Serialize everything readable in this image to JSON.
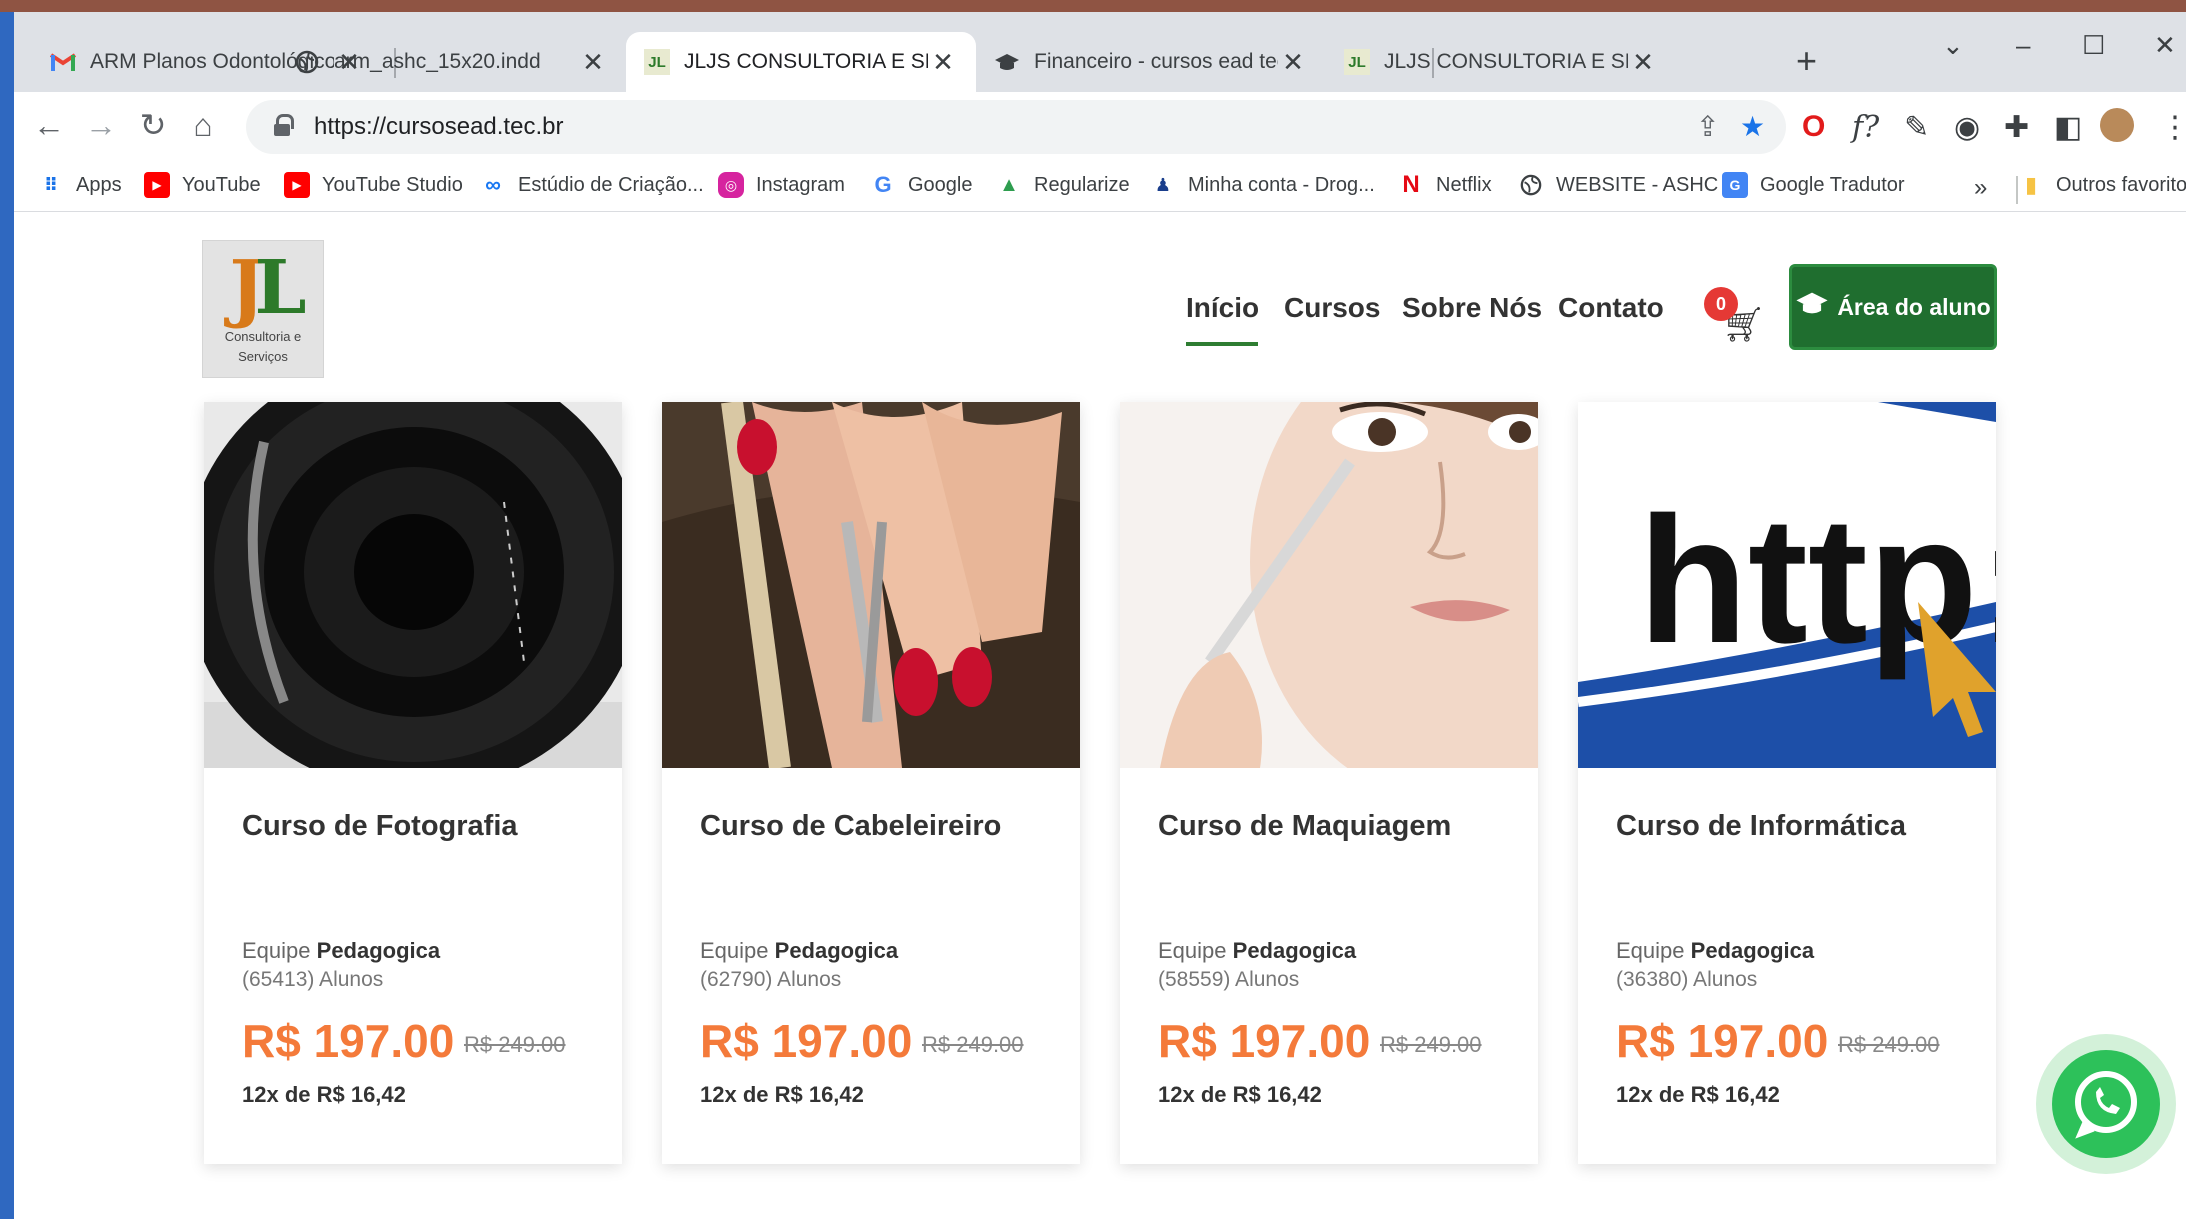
{
  "browser": {
    "tabs": [
      {
        "title": "ARM Planos Odontológico -",
        "icon": "gmail-icon"
      },
      {
        "title": "arm_ashc_15x20.indd",
        "icon": "globe-icon"
      },
      {
        "title": "JLJS CONSULTORIA E SERVIÇ",
        "icon": "jljs-icon",
        "active": true
      },
      {
        "title": "Financeiro - cursos ead tec -",
        "icon": "graduation-cap-icon"
      },
      {
        "title": "JLJS CONSULTORIA E SERVIÇ",
        "icon": "jljs-icon"
      }
    ],
    "close_glyph": "✕",
    "newtab_glyph": "+",
    "url": "https://cursosead.tec.br",
    "bookmarks": [
      {
        "label": "Apps",
        "icon": "apps-grid-icon"
      },
      {
        "label": "YouTube",
        "icon": "youtube-icon"
      },
      {
        "label": "YouTube Studio",
        "icon": "youtube-studio-icon"
      },
      {
        "label": "Estúdio de Criação...",
        "icon": "meta-icon"
      },
      {
        "label": "Instagram",
        "icon": "instagram-icon"
      },
      {
        "label": "Google",
        "icon": "google-icon"
      },
      {
        "label": "Regularize",
        "icon": "regularize-icon"
      },
      {
        "label": "Minha conta - Drog...",
        "icon": "drogaria-icon"
      },
      {
        "label": "Netflix",
        "icon": "netflix-icon"
      },
      {
        "label": "WEBSITE - ASHC",
        "icon": "globe-icon"
      },
      {
        "label": "Google Tradutor",
        "icon": "google-translate-icon"
      },
      {
        "label": "Outros favoritos",
        "icon": "folder-icon"
      }
    ],
    "bookmarks_more": "»"
  },
  "site": {
    "logo": {
      "mark": "JL",
      "text_line1": "Consultoria e",
      "text_line2": "Serviços"
    },
    "nav": [
      {
        "label": "Início",
        "active": true
      },
      {
        "label": "Cursos"
      },
      {
        "label": "Sobre Nós"
      },
      {
        "label": "Contato"
      }
    ],
    "cart_count": "0",
    "student_area_label": "Área do aluno",
    "courses": [
      {
        "title": "Curso de Fotografia",
        "teacher_prefix": "Equipe",
        "teacher": "Pedagogica",
        "students": "(65413) Alunos",
        "price": "R$ 197.00",
        "old_price": "R$ 249.00",
        "installments": "12x de R$ 16,42"
      },
      {
        "title": "Curso de Cabeleireiro",
        "teacher_prefix": "Equipe",
        "teacher": "Pedagogica",
        "students": "(62790) Alunos",
        "price": "R$ 197.00",
        "old_price": "R$ 249.00",
        "installments": "12x de R$ 16,42"
      },
      {
        "title": "Curso de Maquiagem",
        "teacher_prefix": "Equipe",
        "teacher": "Pedagogica",
        "students": "(58559) Alunos",
        "price": "R$ 197.00",
        "old_price": "R$ 249.00",
        "installments": "12x de R$ 16,42"
      },
      {
        "title": "Curso de Informática",
        "teacher_prefix": "Equipe",
        "teacher": "Pedagogica",
        "students": "(36380) Alunos",
        "price": "R$ 197.00",
        "old_price": "R$ 249.00",
        "installments": "12x de R$ 16,42"
      }
    ],
    "course4_image_text": "http://w"
  },
  "colors": {
    "brand_green": "#1f6e2f",
    "price_orange": "#f47a3a",
    "cart_badge": "#e53935",
    "whatsapp": "#2dc15a"
  }
}
